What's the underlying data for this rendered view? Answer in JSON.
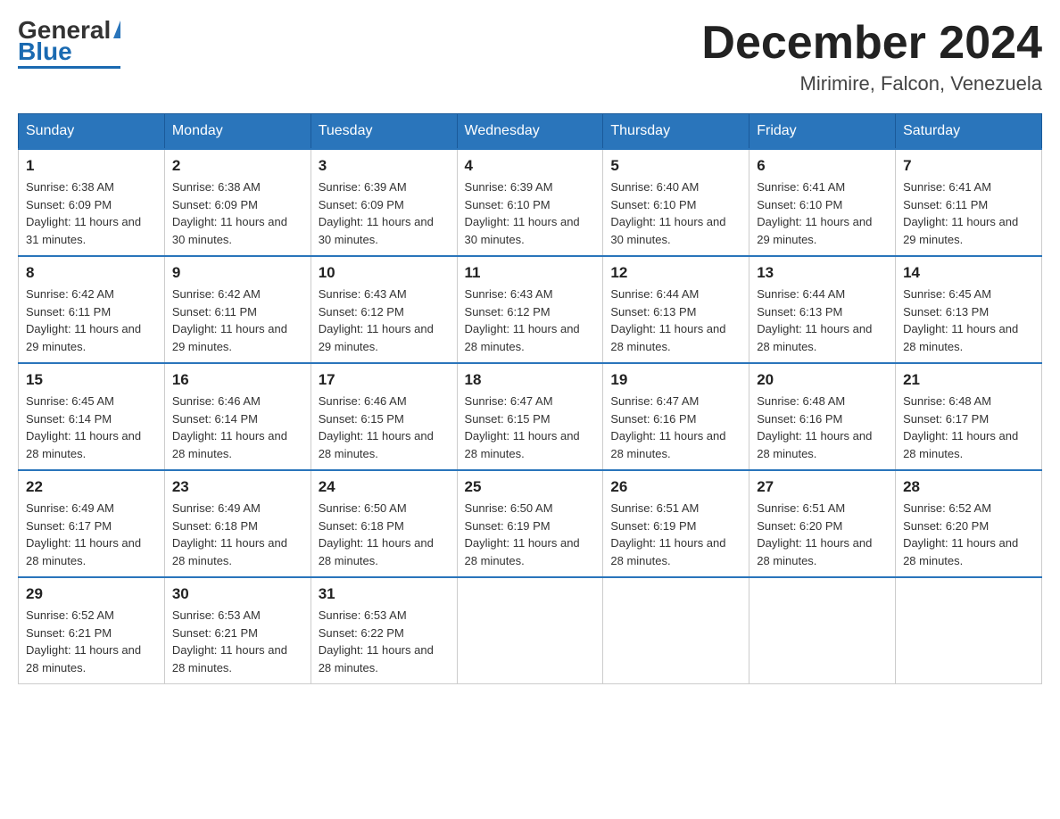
{
  "header": {
    "logo_general": "General",
    "logo_blue": "Blue",
    "month_title": "December 2024",
    "location": "Mirimire, Falcon, Venezuela"
  },
  "weekdays": [
    "Sunday",
    "Monday",
    "Tuesday",
    "Wednesday",
    "Thursday",
    "Friday",
    "Saturday"
  ],
  "weeks": [
    [
      {
        "day": "1",
        "sunrise": "6:38 AM",
        "sunset": "6:09 PM",
        "daylight": "11 hours and 31 minutes."
      },
      {
        "day": "2",
        "sunrise": "6:38 AM",
        "sunset": "6:09 PM",
        "daylight": "11 hours and 30 minutes."
      },
      {
        "day": "3",
        "sunrise": "6:39 AM",
        "sunset": "6:09 PM",
        "daylight": "11 hours and 30 minutes."
      },
      {
        "day": "4",
        "sunrise": "6:39 AM",
        "sunset": "6:10 PM",
        "daylight": "11 hours and 30 minutes."
      },
      {
        "day": "5",
        "sunrise": "6:40 AM",
        "sunset": "6:10 PM",
        "daylight": "11 hours and 30 minutes."
      },
      {
        "day": "6",
        "sunrise": "6:41 AM",
        "sunset": "6:10 PM",
        "daylight": "11 hours and 29 minutes."
      },
      {
        "day": "7",
        "sunrise": "6:41 AM",
        "sunset": "6:11 PM",
        "daylight": "11 hours and 29 minutes."
      }
    ],
    [
      {
        "day": "8",
        "sunrise": "6:42 AM",
        "sunset": "6:11 PM",
        "daylight": "11 hours and 29 minutes."
      },
      {
        "day": "9",
        "sunrise": "6:42 AM",
        "sunset": "6:11 PM",
        "daylight": "11 hours and 29 minutes."
      },
      {
        "day": "10",
        "sunrise": "6:43 AM",
        "sunset": "6:12 PM",
        "daylight": "11 hours and 29 minutes."
      },
      {
        "day": "11",
        "sunrise": "6:43 AM",
        "sunset": "6:12 PM",
        "daylight": "11 hours and 28 minutes."
      },
      {
        "day": "12",
        "sunrise": "6:44 AM",
        "sunset": "6:13 PM",
        "daylight": "11 hours and 28 minutes."
      },
      {
        "day": "13",
        "sunrise": "6:44 AM",
        "sunset": "6:13 PM",
        "daylight": "11 hours and 28 minutes."
      },
      {
        "day": "14",
        "sunrise": "6:45 AM",
        "sunset": "6:13 PM",
        "daylight": "11 hours and 28 minutes."
      }
    ],
    [
      {
        "day": "15",
        "sunrise": "6:45 AM",
        "sunset": "6:14 PM",
        "daylight": "11 hours and 28 minutes."
      },
      {
        "day": "16",
        "sunrise": "6:46 AM",
        "sunset": "6:14 PM",
        "daylight": "11 hours and 28 minutes."
      },
      {
        "day": "17",
        "sunrise": "6:46 AM",
        "sunset": "6:15 PM",
        "daylight": "11 hours and 28 minutes."
      },
      {
        "day": "18",
        "sunrise": "6:47 AM",
        "sunset": "6:15 PM",
        "daylight": "11 hours and 28 minutes."
      },
      {
        "day": "19",
        "sunrise": "6:47 AM",
        "sunset": "6:16 PM",
        "daylight": "11 hours and 28 minutes."
      },
      {
        "day": "20",
        "sunrise": "6:48 AM",
        "sunset": "6:16 PM",
        "daylight": "11 hours and 28 minutes."
      },
      {
        "day": "21",
        "sunrise": "6:48 AM",
        "sunset": "6:17 PM",
        "daylight": "11 hours and 28 minutes."
      }
    ],
    [
      {
        "day": "22",
        "sunrise": "6:49 AM",
        "sunset": "6:17 PM",
        "daylight": "11 hours and 28 minutes."
      },
      {
        "day": "23",
        "sunrise": "6:49 AM",
        "sunset": "6:18 PM",
        "daylight": "11 hours and 28 minutes."
      },
      {
        "day": "24",
        "sunrise": "6:50 AM",
        "sunset": "6:18 PM",
        "daylight": "11 hours and 28 minutes."
      },
      {
        "day": "25",
        "sunrise": "6:50 AM",
        "sunset": "6:19 PM",
        "daylight": "11 hours and 28 minutes."
      },
      {
        "day": "26",
        "sunrise": "6:51 AM",
        "sunset": "6:19 PM",
        "daylight": "11 hours and 28 minutes."
      },
      {
        "day": "27",
        "sunrise": "6:51 AM",
        "sunset": "6:20 PM",
        "daylight": "11 hours and 28 minutes."
      },
      {
        "day": "28",
        "sunrise": "6:52 AM",
        "sunset": "6:20 PM",
        "daylight": "11 hours and 28 minutes."
      }
    ],
    [
      {
        "day": "29",
        "sunrise": "6:52 AM",
        "sunset": "6:21 PM",
        "daylight": "11 hours and 28 minutes."
      },
      {
        "day": "30",
        "sunrise": "6:53 AM",
        "sunset": "6:21 PM",
        "daylight": "11 hours and 28 minutes."
      },
      {
        "day": "31",
        "sunrise": "6:53 AM",
        "sunset": "6:22 PM",
        "daylight": "11 hours and 28 minutes."
      },
      null,
      null,
      null,
      null
    ]
  ],
  "labels": {
    "sunrise_prefix": "Sunrise: ",
    "sunset_prefix": "Sunset: ",
    "daylight_prefix": "Daylight: "
  }
}
